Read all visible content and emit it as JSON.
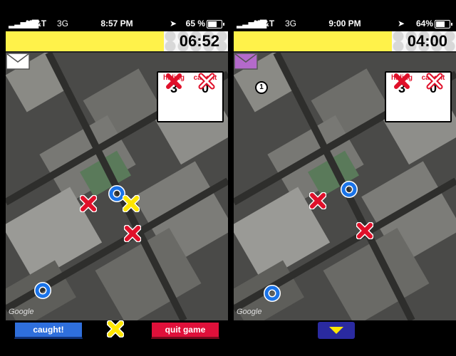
{
  "colors": {
    "timer_bar": "#fff24a",
    "red_marker": "#e0102a",
    "yellow_marker": "#ffe600",
    "blue_marker": "#1a73e8",
    "caught_button": "#2f6fdc",
    "quit_button": "#e0103a",
    "envelope_new": "#b46acb"
  },
  "screens": [
    {
      "status": {
        "carrier": "AT&T",
        "network": "3G",
        "time": "8:57 PM",
        "battery": "65 %"
      },
      "timer": "06:52",
      "message_icon": "envelope-icon",
      "message_badge": "",
      "score": {
        "hiding_label": "hiding",
        "caught_label": "caught",
        "hiding_value": "3",
        "caught_value": "0"
      },
      "google_label": "Google",
      "buttons": {
        "caught": "caught!",
        "quit": "quit game"
      }
    },
    {
      "status": {
        "carrier": "AT&T",
        "network": "3G",
        "time": "9:00 PM",
        "battery": "64%"
      },
      "timer": "04:00",
      "message_icon": "envelope-icon",
      "message_badge": "1",
      "score": {
        "hiding_label": "hiding",
        "caught_label": "caught",
        "hiding_value": "3",
        "caught_value": "0"
      },
      "google_label": "Google",
      "buttons": {
        "expand": "chevron-down-icon"
      }
    }
  ]
}
